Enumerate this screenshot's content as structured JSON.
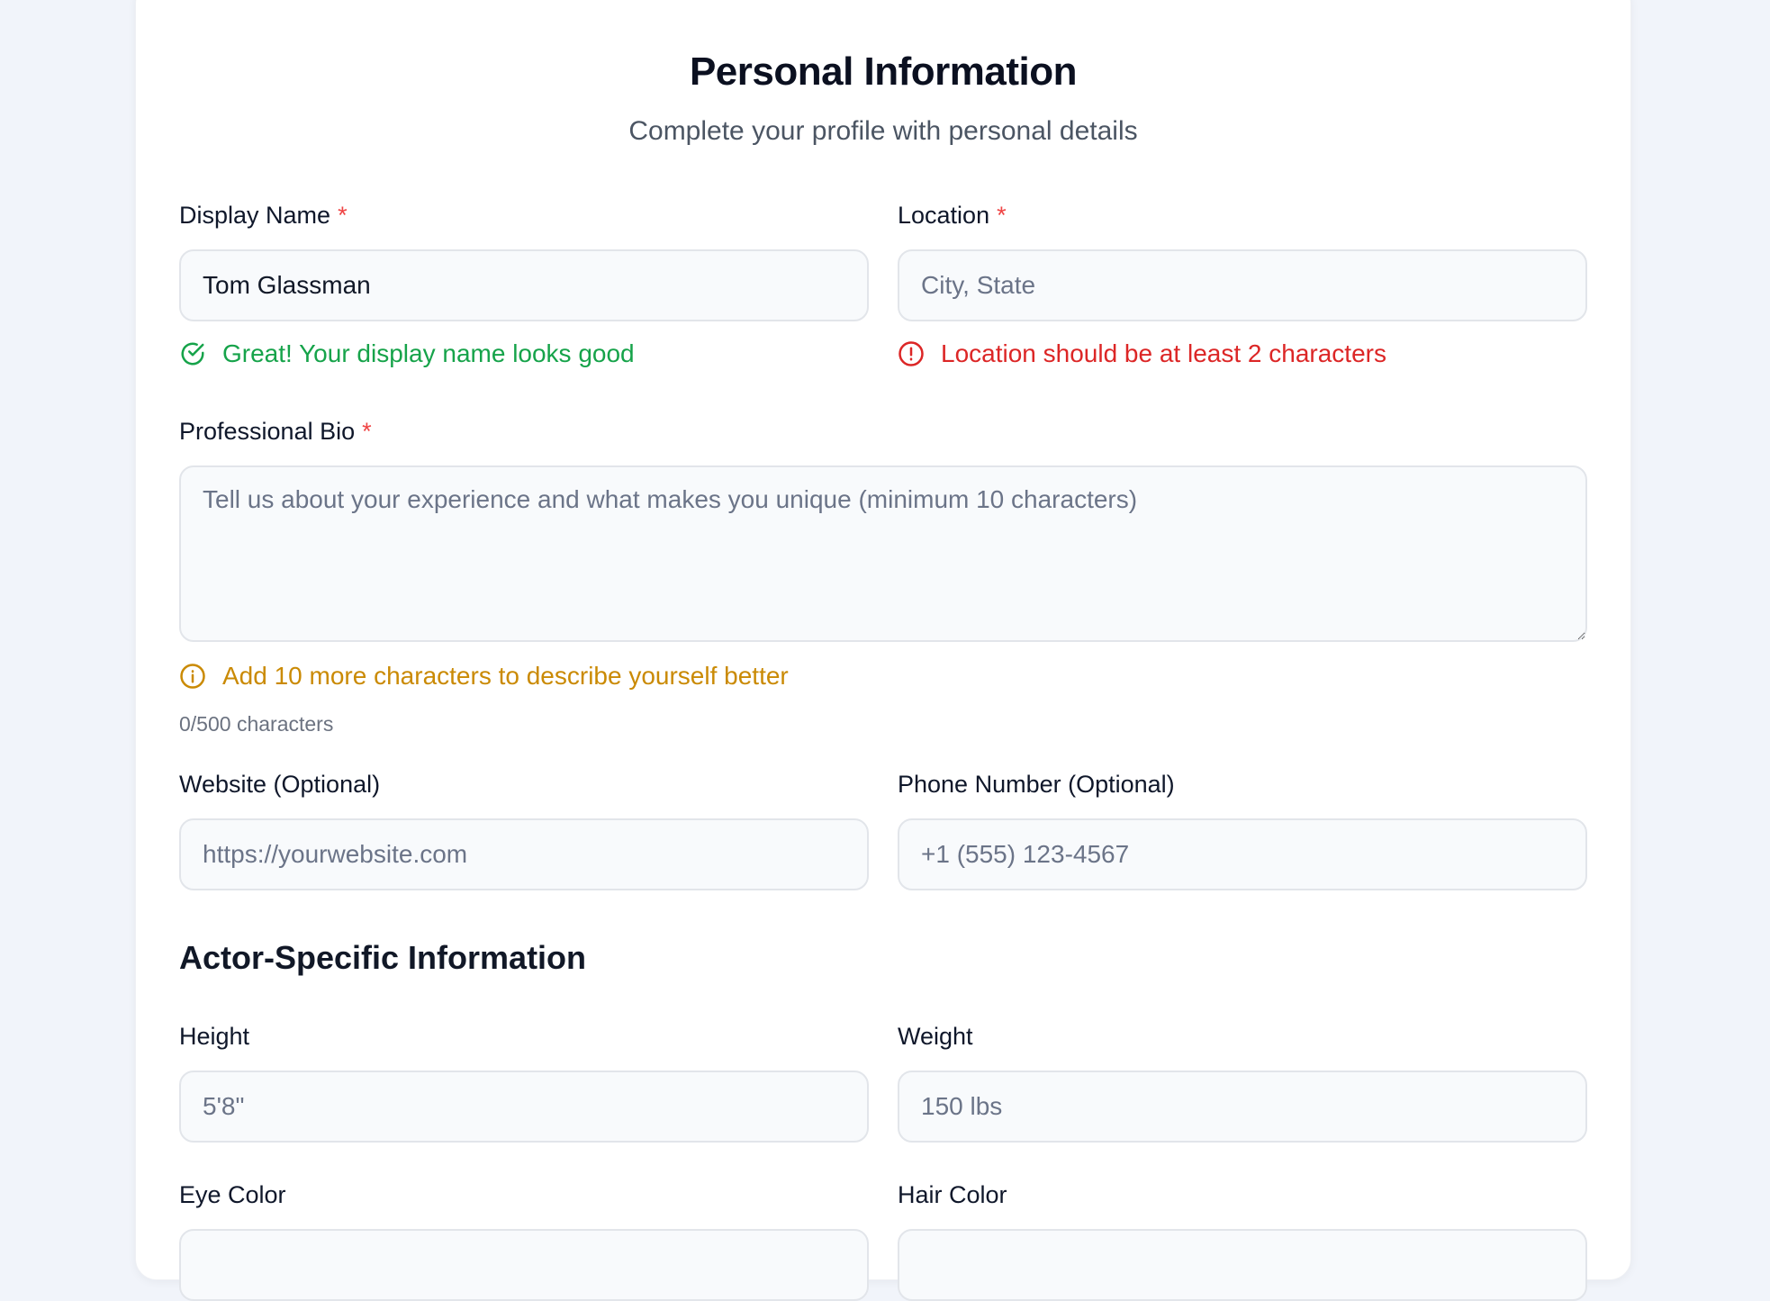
{
  "header": {
    "title": "Personal Information",
    "subtitle": "Complete your profile with personal details"
  },
  "fields": {
    "display_name": {
      "label": "Display Name",
      "required_mark": "*",
      "value": "Tom Glassman",
      "placeholder": "",
      "message": "Great! Your display name looks good"
    },
    "location": {
      "label": "Location",
      "required_mark": "*",
      "value": "",
      "placeholder": "City, State",
      "message": "Location should be at least 2 characters"
    },
    "bio": {
      "label": "Professional Bio",
      "required_mark": "*",
      "value": "",
      "placeholder": "Tell us about your experience and what makes you unique (minimum 10 characters)",
      "message": "Add 10 more characters to describe yourself better",
      "counter": "0/500 characters"
    },
    "website": {
      "label": "Website (Optional)",
      "placeholder": "https://yourwebsite.com"
    },
    "phone": {
      "label": "Phone Number (Optional)",
      "placeholder": "+1 (555) 123-4567"
    }
  },
  "actor_section": {
    "title": "Actor-Specific Information",
    "height": {
      "label": "Height",
      "placeholder": "5'8\""
    },
    "weight": {
      "label": "Weight",
      "placeholder": "150 lbs"
    },
    "eye_color": {
      "label": "Eye Color"
    },
    "hair_color": {
      "label": "Hair Color"
    }
  },
  "colors": {
    "success": "#16a34a",
    "error": "#dc2626",
    "warning": "#ca8a04",
    "required": "#ef4444"
  },
  "icons": {
    "success": "check-circle-icon",
    "error": "alert-circle-icon",
    "warning": "info-circle-icon"
  }
}
